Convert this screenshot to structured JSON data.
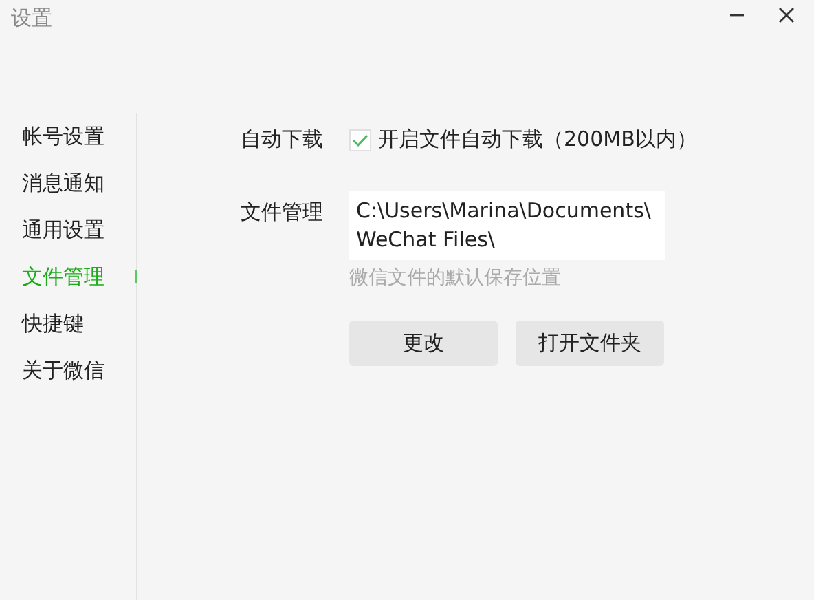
{
  "window": {
    "title": "设置"
  },
  "sidebar": {
    "items": [
      {
        "label": "帐号设置",
        "selected": false
      },
      {
        "label": "消息通知",
        "selected": false
      },
      {
        "label": "通用设置",
        "selected": false
      },
      {
        "label": "文件管理",
        "selected": true
      },
      {
        "label": "快捷键",
        "selected": false
      },
      {
        "label": "关于微信",
        "selected": false
      }
    ]
  },
  "auto_download": {
    "label": "自动下载",
    "checkbox_label": "开启文件自动下载（200MB以内）",
    "checked": true
  },
  "file_management": {
    "label": "文件管理",
    "path_lines": [
      "C:\\Users\\Marina\\Documents\\",
      "WeChat Files\\"
    ],
    "hint": "微信文件的默认保存位置"
  },
  "buttons": [
    "更改",
    "打开文件夹"
  ]
}
